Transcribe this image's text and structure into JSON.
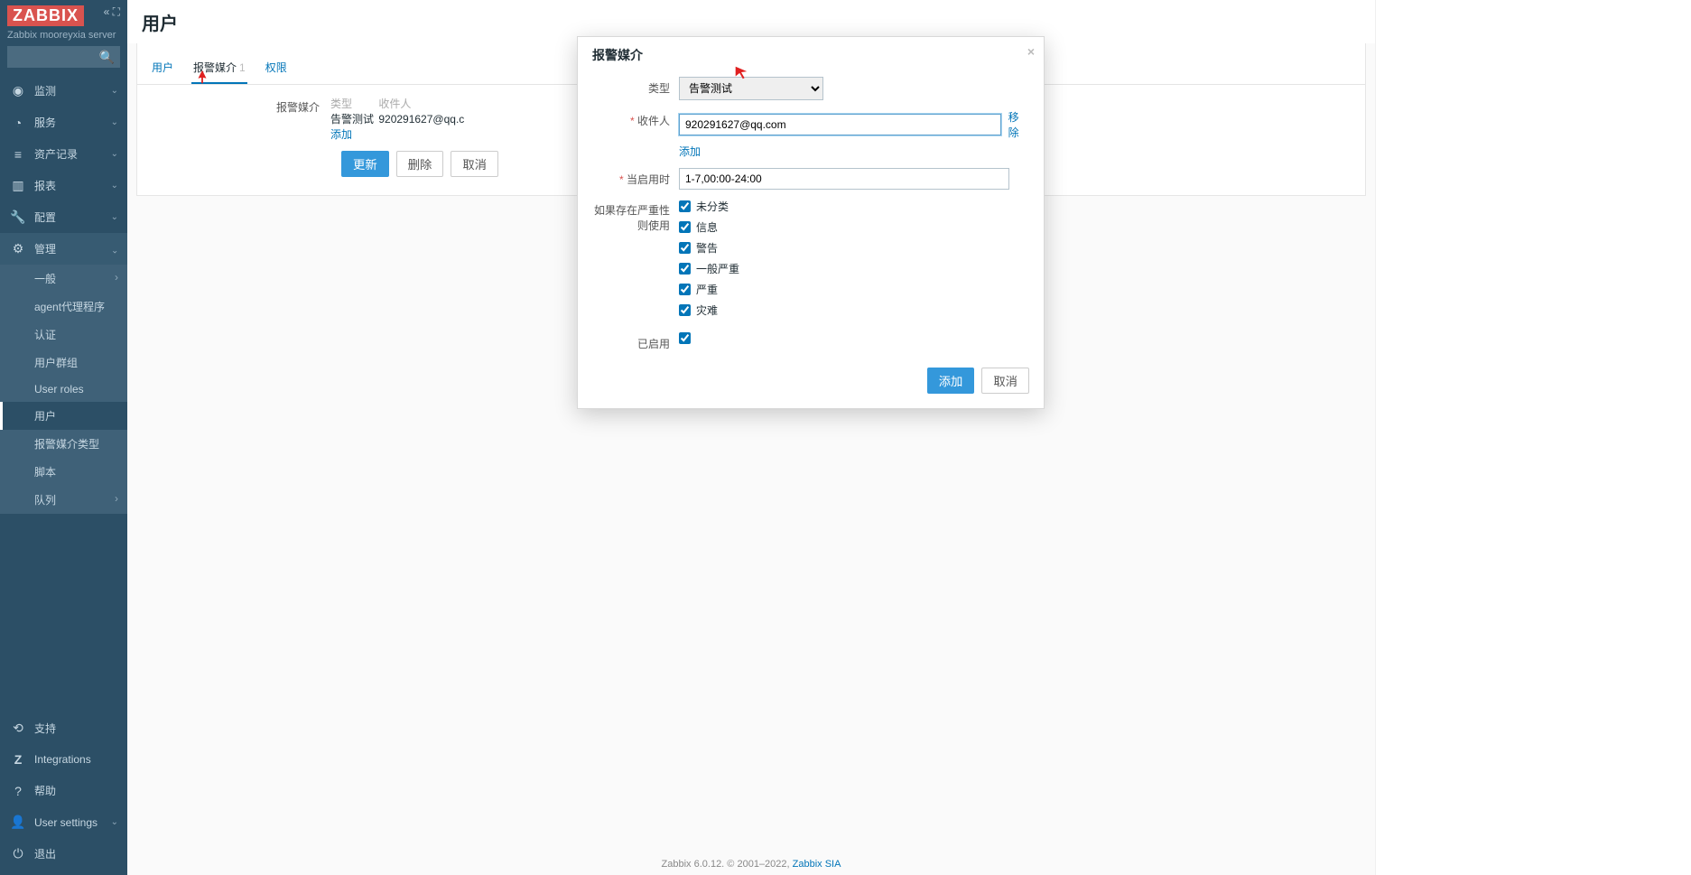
{
  "sidebar": {
    "logo": "ZABBIX",
    "server_name": "Zabbix mooreyxia server",
    "search_placeholder": "",
    "items": [
      {
        "label": "监测",
        "icon": "◉"
      },
      {
        "label": "服务",
        "icon": "◔"
      },
      {
        "label": "资产记录",
        "icon": "≡"
      },
      {
        "label": "报表",
        "icon": "▥"
      },
      {
        "label": "配置",
        "icon": "🔧"
      },
      {
        "label": "管理",
        "icon": "⚙"
      }
    ],
    "admin_sub": [
      {
        "label": "一般",
        "has_caret": true
      },
      {
        "label": "agent代理程序"
      },
      {
        "label": "认证"
      },
      {
        "label": "用户群组"
      },
      {
        "label": "User roles"
      },
      {
        "label": "用户",
        "active": true
      },
      {
        "label": "报警媒介类型"
      },
      {
        "label": "脚本"
      },
      {
        "label": "队列",
        "has_caret": true
      }
    ],
    "bottom": [
      {
        "label": "支持",
        "icon": "⟲"
      },
      {
        "label": "Integrations",
        "icon": "Z"
      },
      {
        "label": "帮助",
        "icon": "?"
      },
      {
        "label": "User settings",
        "icon": "👤"
      },
      {
        "label": "退出",
        "icon": "⏻"
      }
    ]
  },
  "page": {
    "title": "用户",
    "tabs": [
      {
        "label": "用户"
      },
      {
        "label": "报警媒介",
        "count": "1",
        "active": true
      },
      {
        "label": "权限"
      }
    ],
    "media_section_label": "报警媒介",
    "media_headers": {
      "type": "类型",
      "recipient": "收件人"
    },
    "media_rows": [
      {
        "type": "告警测试",
        "recipient": "920291627@qq.c"
      }
    ],
    "add_link": "添加",
    "buttons": {
      "update": "更新",
      "delete": "删除",
      "cancel": "取消"
    }
  },
  "modal": {
    "title": "报警媒介",
    "labels": {
      "type": "类型",
      "recipient": "收件人",
      "add": "添加",
      "remove": "移除",
      "when_active": "当启用时",
      "use_if_severity": "如果存在严重性则使用",
      "enabled": "已启用"
    },
    "type_value": "告警测试",
    "recipient_value": "920291627@qq.com",
    "when_active_value": "1-7,00:00-24:00",
    "severities": [
      "未分类",
      "信息",
      "警告",
      "一般严重",
      "严重",
      "灾难"
    ],
    "enabled_checked": true,
    "buttons": {
      "add": "添加",
      "cancel": "取消"
    }
  },
  "footer": {
    "text_left": "Zabbix 6.0.12. © 2001–2022, ",
    "link": "Zabbix SIA"
  }
}
